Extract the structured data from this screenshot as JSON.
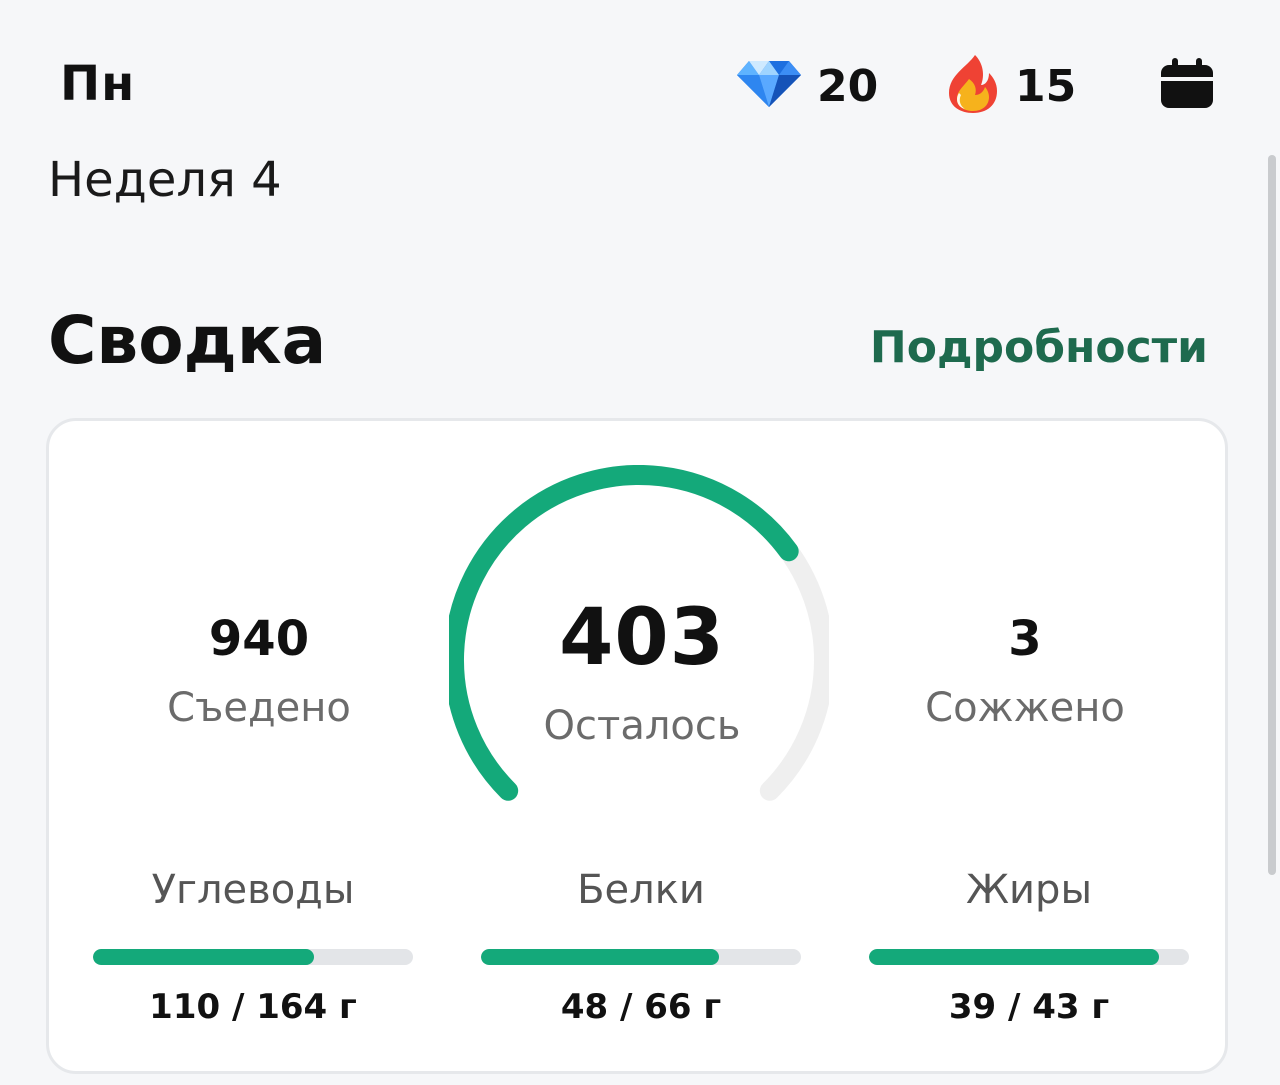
{
  "header": {
    "day": "Пн",
    "gems": {
      "icon": "diamond-icon",
      "value": "20"
    },
    "streak": {
      "icon": "flame-icon",
      "value": "15"
    },
    "calendar_icon": "calendar-icon"
  },
  "week_label": "Неделя 4",
  "summary": {
    "title": "Сводка",
    "details_link": "Подробности",
    "eaten": {
      "value": "940",
      "label": "Съедено"
    },
    "remaining": {
      "value": "403",
      "label": "Осталось",
      "progress": 0.7
    },
    "burned": {
      "value": "3",
      "label": "Сожжено"
    },
    "macros": [
      {
        "name": "Углеводы",
        "amount": "110 / 164 г",
        "fraction": 0.69
      },
      {
        "name": "Белки",
        "amount": "48 / 66 г",
        "fraction": 0.745
      },
      {
        "name": "Жиры",
        "amount": "39 / 43 г",
        "fraction": 0.905
      }
    ]
  },
  "colors": {
    "accent": "#14a97a",
    "link": "#1e6a4e",
    "track": "#e3e5e8",
    "background": "#f6f7f9"
  }
}
